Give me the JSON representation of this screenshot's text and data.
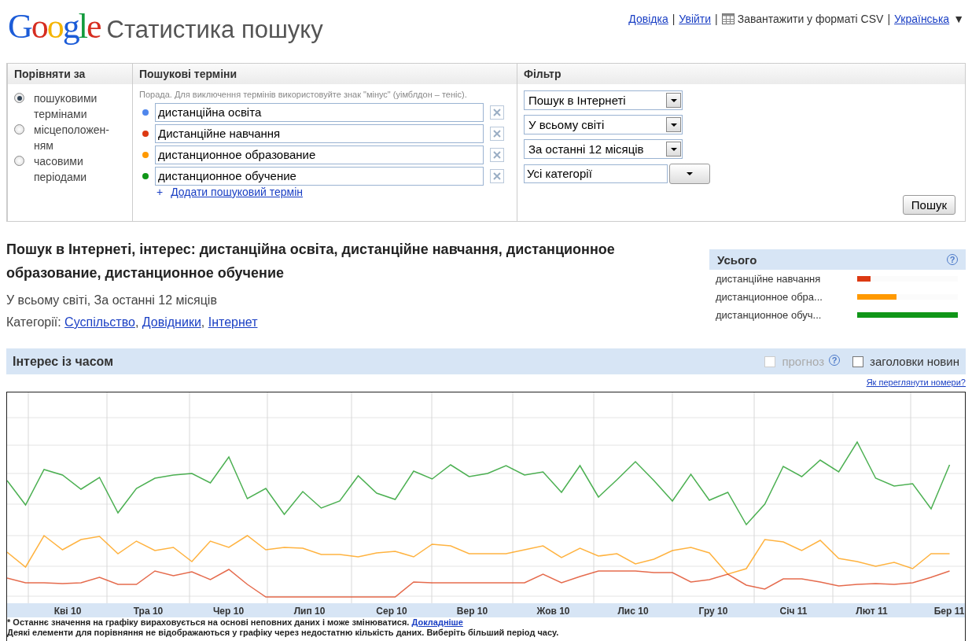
{
  "header": {
    "logo": "Google",
    "title": "Статистика пошуку",
    "separator": "|",
    "links": [
      {
        "label": "Довідка",
        "kind": "link"
      },
      {
        "label": "Увійти",
        "kind": "link"
      },
      {
        "label": "Завантажити у форматі CSV",
        "kind": "csv"
      },
      {
        "label": "Українська",
        "kind": "language",
        "caret": "▼"
      }
    ]
  },
  "compare": {
    "heading": "Порівняти за",
    "options": [
      {
        "label": "пошуковими термінами",
        "selected": true
      },
      {
        "label": "місцеположен-ням",
        "selected": false
      },
      {
        "label": "часовими періодами",
        "selected": false
      }
    ]
  },
  "terms": {
    "heading": "Пошукові терміни",
    "hint": "Порада. Для виключення термінів використовуйте знак \"мінус\" (уімблдон – теніс).",
    "items": [
      {
        "value": "дистанційна освіта",
        "color": "#4f86ec"
      },
      {
        "value": "Дистанційне навчання",
        "color": "#dc3912"
      },
      {
        "value": "дистанционное образование",
        "color": "#ff9900"
      },
      {
        "value": "дистанционное обучение",
        "color": "#109618"
      }
    ],
    "add": {
      "icon": "+",
      "label": "Додати пошуковий термін"
    }
  },
  "filter": {
    "heading": "Фільтр",
    "selects": [
      "Пошук в Інтернеті",
      "У всьому світі",
      "За останні 12 місяців"
    ],
    "category": "Усі категорії",
    "button": "Пошук"
  },
  "summary": {
    "title": "Пошук в Інтернеті, інтерес: дистанційна освіта, дистанційне навчання, дистанционное образование, дистанционное обучение",
    "scope": "У всьому світі, За останні 12 місяців",
    "categories_label": "Категорії:",
    "separator": ",",
    "categories": [
      "Суспільство",
      "Довідники",
      "Інтернет"
    ]
  },
  "totals": {
    "heading": "Усього",
    "help": "?",
    "items": [
      {
        "label": "дистанційне навчання",
        "color": "#dc3912",
        "level": 0.13
      },
      {
        "label": "дистанционное обра...",
        "color": "#ff9900",
        "level": 0.39
      },
      {
        "label": "дистанционное обуч...",
        "color": "#109618",
        "level": 1
      }
    ]
  },
  "interest": {
    "title": "Інтерес із часом",
    "options": [
      {
        "label": "прогноз",
        "checked": false,
        "disabled": true,
        "help": "?"
      },
      {
        "label": "заголовки новин",
        "checked": false,
        "disabled": false
      }
    ],
    "link": "Як переглянути номери?"
  },
  "chart": {
    "x_labels": [
      "Кві 10",
      "Тра 10",
      "Чер 10",
      "Лип 10",
      "Сер 10",
      "Вер 10",
      "Жов 10",
      "Лис 10",
      "Гру 10",
      "Січ 11",
      "Лют 11",
      "Бер 11"
    ],
    "note": "* Останнє значення на графіку вираховується на основі неповних даних і може змінюватися.",
    "note_link": "Докладніше",
    "note2": "Деякі елементи для порівняння не відображаються у графіку через недостатню кількість даних. Виберіть більший період часу."
  }
}
